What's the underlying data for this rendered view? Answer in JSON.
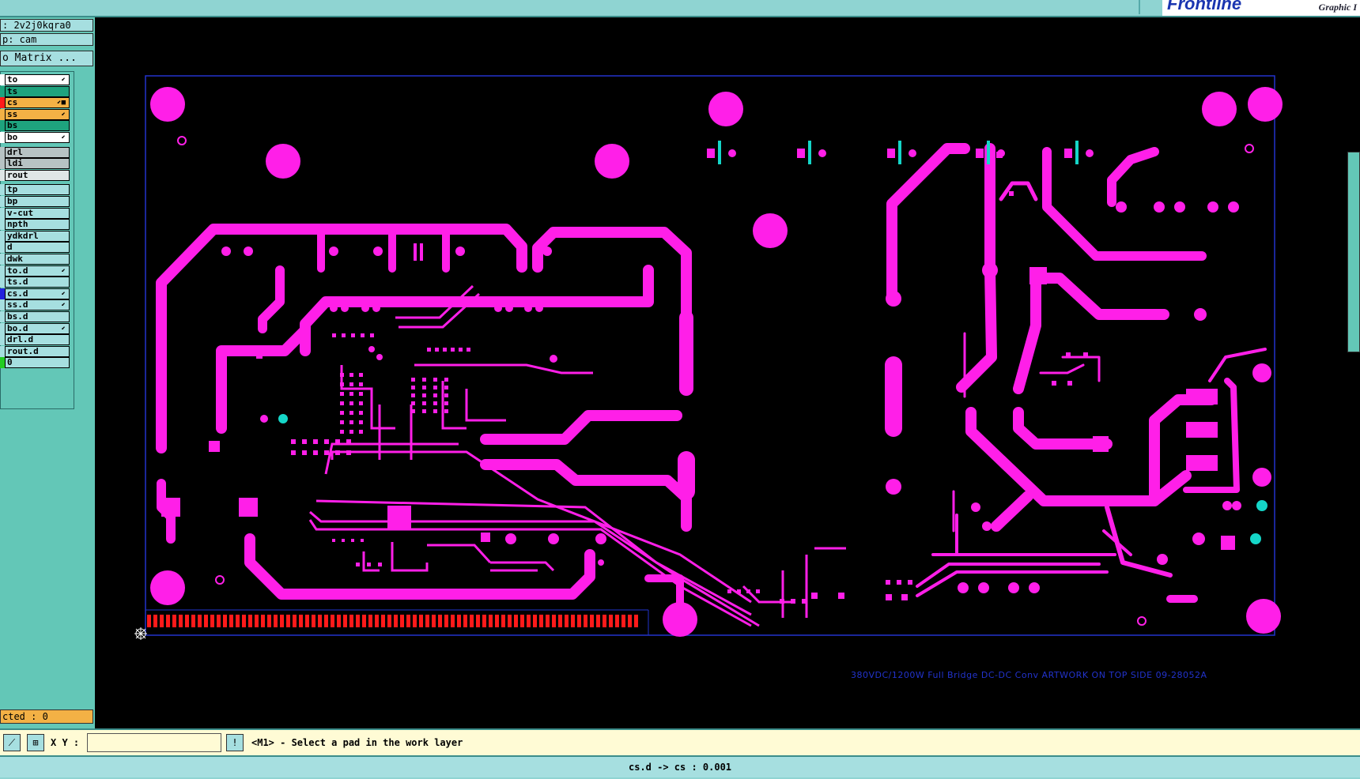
{
  "top": {
    "brand": "Frontline",
    "brand_sub": "Graphic I"
  },
  "left": {
    "job": ": 2v2j0kqra0",
    "step": "p: cam",
    "matrix_button": "o Matrix ...",
    "selected_count": "cted : 0",
    "layers": [
      {
        "name": "to",
        "color": "#ffffff",
        "swatch": "#ffffff",
        "mark": "⬋"
      },
      {
        "name": "ts",
        "color": "#1ea37e",
        "swatch": "#1ea37e",
        "mark": ""
      },
      {
        "name": "cs",
        "color": "#f3b145",
        "swatch": "#ff1a1a",
        "mark": "⬋■"
      },
      {
        "name": "ss",
        "color": "#f3b145",
        "swatch": "#f3b145",
        "mark": "⬋"
      },
      {
        "name": "bs",
        "color": "#1ea37e",
        "swatch": "#1ea37e",
        "mark": ""
      },
      {
        "name": "bo",
        "color": "#ffffff",
        "swatch": "#ffffff",
        "mark": "⬋"
      },
      {
        "name": "drl",
        "color": "#b7c3c4",
        "swatch": "#b7c3c4",
        "mark": ""
      },
      {
        "name": "ldi",
        "color": "#b7c3c4",
        "swatch": "#b7c3c4",
        "mark": ""
      },
      {
        "name": "rout",
        "color": "#dfe6e6",
        "swatch": "#dfe6e6",
        "mark": ""
      },
      {
        "name": "tp",
        "color": "#a6dfe0",
        "swatch": "#a6dfe0",
        "mark": ""
      },
      {
        "name": "bp",
        "color": "#a6dfe0",
        "swatch": "#a6dfe0",
        "mark": ""
      },
      {
        "name": "v-cut",
        "color": "#a6dfe0",
        "swatch": "#a6dfe0",
        "mark": ""
      },
      {
        "name": "npth",
        "color": "#a6dfe0",
        "swatch": "#a6dfe0",
        "mark": ""
      },
      {
        "name": "ydkdrl",
        "color": "#a6dfe0",
        "swatch": "#a6dfe0",
        "mark": ""
      },
      {
        "name": "d",
        "color": "#a6dfe0",
        "swatch": "#a6dfe0",
        "mark": ""
      },
      {
        "name": "dwk",
        "color": "#a6dfe0",
        "swatch": "#a6dfe0",
        "mark": ""
      },
      {
        "name": "to.d",
        "color": "#a6dfe0",
        "swatch": "#a6dfe0",
        "mark": "⬋"
      },
      {
        "name": "ts.d",
        "color": "#a6dfe0",
        "swatch": "#a6dfe0",
        "mark": ""
      },
      {
        "name": "cs.d",
        "color": "#a6dfe0",
        "swatch": "#2222dd",
        "mark": "⬋"
      },
      {
        "name": "ss.d",
        "color": "#a6dfe0",
        "swatch": "#a6dfe0",
        "mark": "⬋"
      },
      {
        "name": "bs.d",
        "color": "#a6dfe0",
        "swatch": "#a6dfe0",
        "mark": ""
      },
      {
        "name": "bo.d",
        "color": "#a6dfe0",
        "swatch": "#a6dfe0",
        "mark": "⬋"
      },
      {
        "name": "drl.d",
        "color": "#a6dfe0",
        "swatch": "#a6dfe0",
        "mark": ""
      },
      {
        "name": "rout.d",
        "color": "#a6dfe0",
        "swatch": "#a6dfe0",
        "mark": ""
      },
      {
        "name": "0",
        "color": "#a6dfe0",
        "swatch": "#22cc22",
        "mark": ""
      }
    ]
  },
  "status": {
    "xy_label": "X Y :",
    "xy_value": "",
    "prompt": "<M1> - Select a pad in the work layer",
    "footer": "cs.d -> cs : 0.001"
  },
  "board": {
    "caption": "380VDC/1200W Full Bridge DC-DC Conv ARTWORK ON TOP SIDE 09-28052A",
    "trace_color": "#ff1fe8",
    "pad_color_alt": "#15d6c8",
    "outline_color": "#2233cc",
    "connector_color": "#ff1a1a"
  },
  "icons": [
    "measure-icon",
    "snap-grid-icon",
    "alert-icon"
  ]
}
